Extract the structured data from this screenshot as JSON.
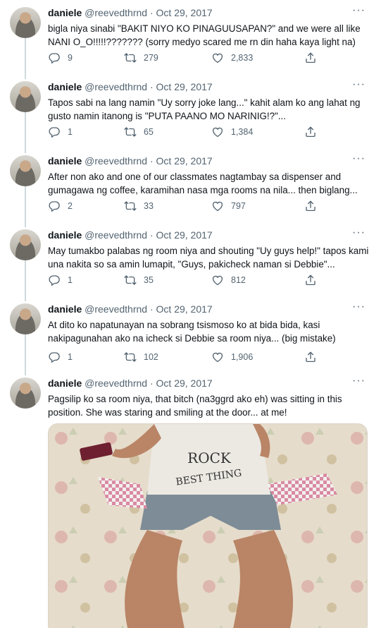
{
  "tweets": [
    {
      "name": "daniele",
      "handle": "@reevedthrnd",
      "sep": "·",
      "date": "Oct 29, 2017",
      "more": "···",
      "text": "bigla niya sinabi \"BAKIT NIYO KO PINAGUUSAPAN?\" and we were all like NANI O_O!!!!!??????? (sorry medyo scared me rn din haha kaya light na)",
      "replies": "9",
      "retweets": "279",
      "likes": "2,833"
    },
    {
      "name": "daniele",
      "handle": "@reevedthrnd",
      "sep": "·",
      "date": "Oct 29, 2017",
      "more": "···",
      "text": "Tapos sabi na lang namin \"Uy sorry joke lang...\" kahit alam ko ang lahat ng gusto namin itanong is \"PUTA PAANO MO NARINIG!?\"...",
      "replies": "1",
      "retweets": "65",
      "likes": "1,384"
    },
    {
      "name": "daniele",
      "handle": "@reevedthrnd",
      "sep": "·",
      "date": "Oct 29, 2017",
      "more": "···",
      "text": "After non ako and one of our classmates nagtambay sa dispenser and gumagawa ng coffee, karamihan nasa mga rooms na nila... then biglang...",
      "replies": "2",
      "retweets": "33",
      "likes": "797"
    },
    {
      "name": "daniele",
      "handle": "@reevedthrnd",
      "sep": "·",
      "date": "Oct 29, 2017",
      "more": "···",
      "text": "May tumakbo palabas ng room niya and shouting \"Uy guys help!\" tapos kami una nakita so sa amin lumapit, \"Guys, pakicheck naman si Debbie\"...",
      "replies": "1",
      "retweets": "35",
      "likes": "812"
    },
    {
      "name": "daniele",
      "handle": "@reevedthrnd",
      "sep": "·",
      "date": "Oct 29, 2017",
      "more": "···",
      "text": "At dito ko napatunayan na sobrang tsismoso ko at bida bida, kasi nakipagunahan ako na icheck si Debbie sa room niya... (big mistake)",
      "replies": "1",
      "retweets": "102",
      "likes": "1,906"
    },
    {
      "name": "daniele",
      "handle": "@reevedthrnd",
      "sep": "·",
      "date": "Oct 29, 2017",
      "more": "···",
      "text": "Pagsilip ko sa room niya, that bitch (na3ggrd ako eh) was sitting in this position. She was staring and smiling at the door... at me!"
    }
  ],
  "photo": {
    "shirt_text_1": "ROCK",
    "shirt_text_2": "BEST THING"
  },
  "colors": {
    "muted": "#536471",
    "text": "#0f1419",
    "line": "#cfd9de"
  }
}
